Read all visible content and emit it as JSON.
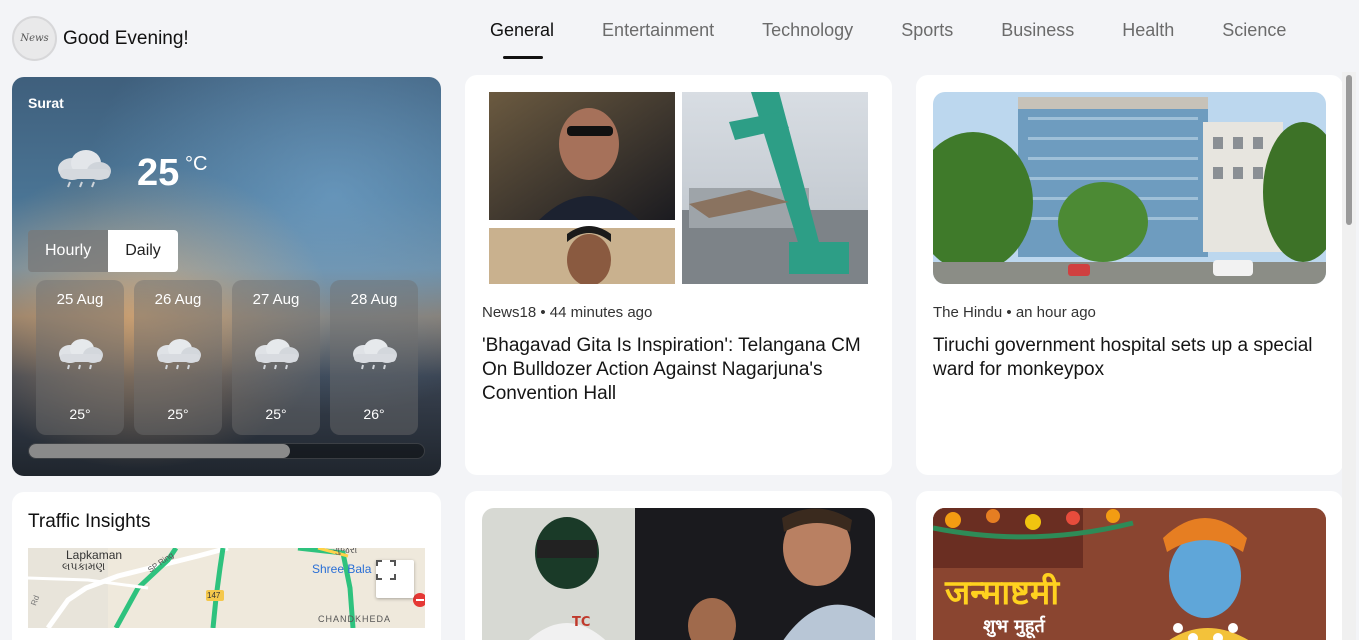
{
  "header": {
    "logo_text": "News",
    "greeting": "Good Evening!"
  },
  "tabs": [
    "General",
    "Entertainment",
    "Technology",
    "Sports",
    "Business",
    "Health",
    "Science"
  ],
  "active_tab": "General",
  "weather": {
    "city": "Surat",
    "temperature": "25",
    "unit": "°C",
    "toggle": {
      "hourly": "Hourly",
      "daily": "Daily",
      "selected": "Daily"
    },
    "icon": "rain-cloud-icon",
    "days": [
      {
        "date": "25 Aug",
        "temp": "25°",
        "icon": "rain-cloud-icon"
      },
      {
        "date": "26 Aug",
        "temp": "25°",
        "icon": "rain-cloud-icon"
      },
      {
        "date": "27 Aug",
        "temp": "25°",
        "icon": "rain-cloud-icon"
      },
      {
        "date": "28 Aug",
        "temp": "26°",
        "icon": "rain-cloud-icon"
      }
    ],
    "scroll_fraction": 0.66
  },
  "traffic": {
    "title": "Traffic Insights",
    "map_labels": {
      "lapkaman": "Lapkaman",
      "lapkaman_local": "લપકામણ",
      "shree_bala": "Shree Bala",
      "chandkheda": "CHANDKHEDA",
      "road": "147",
      "sp_ring": "SP Ring",
      "gujarati_top": "ગુજરા",
      "rd": "Rd"
    }
  },
  "news": [
    {
      "source": "News18",
      "time": "44 minutes ago",
      "title": "'Bhagavad Gita Is Inspiration': Telangana CM On Bulldozer Action Against Nagarjuna's Convention Hall"
    },
    {
      "source": "The Hindu",
      "time": "an hour ago",
      "title": "Tiruchi government hospital sets up a special ward for monkeypox"
    },
    {
      "source": "",
      "time": "",
      "title": ""
    },
    {
      "source": "",
      "time": "",
      "title": "",
      "image_text": "जन्माष्टमी",
      "image_subtext": "शुभ मुहूर्त"
    }
  ],
  "colors": {
    "background": "#f3f4f7",
    "card": "#ffffff",
    "active_tab": "#111111",
    "inactive_tab": "#6b6b6b",
    "map_route": "#2ec27e"
  }
}
